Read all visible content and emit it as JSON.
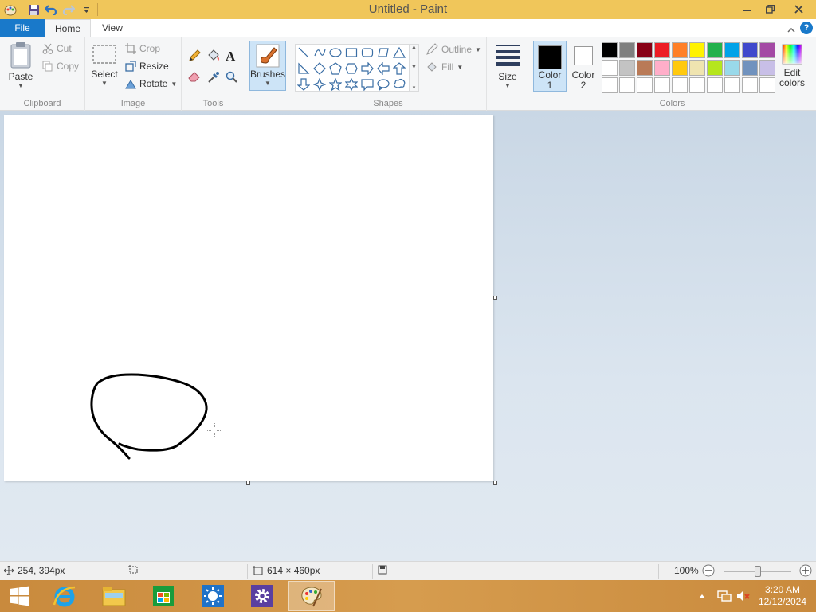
{
  "window": {
    "title": "Untitled - Paint"
  },
  "tabs": {
    "file": "File",
    "home": "Home",
    "view": "View",
    "help": "?"
  },
  "clipboard": {
    "label": "Clipboard",
    "paste": "Paste",
    "cut": "Cut",
    "copy": "Copy"
  },
  "image": {
    "label": "Image",
    "select": "Select",
    "crop": "Crop",
    "resize": "Resize",
    "rotate": "Rotate"
  },
  "tools": {
    "label": "Tools",
    "text_glyph": "A"
  },
  "brushes": {
    "label": "Brushes"
  },
  "shapes": {
    "label": "Shapes",
    "outline": "Outline",
    "fill": "Fill"
  },
  "size": {
    "label": "Size"
  },
  "colors": {
    "label": "Colors",
    "color1_label": "Color",
    "color1_num": "1",
    "color2_label": "Color",
    "color2_num": "2",
    "edit_label": "Edit",
    "edit_label2": "colors",
    "color1_value": "#000000",
    "color2_value": "#ffffff",
    "palette": [
      "#000000",
      "#7f7f7f",
      "#880015",
      "#ed1c24",
      "#ff7f27",
      "#fff200",
      "#22b14c",
      "#00a2e8",
      "#3f48cc",
      "#a349a4",
      "#ffffff",
      "#c3c3c3",
      "#b97a57",
      "#ffaec9",
      "#ffc90e",
      "#efe4b0",
      "#b5e61d",
      "#99d9ea",
      "#7092be",
      "#c8bfe7",
      "#ffffff",
      "#ffffff",
      "#ffffff",
      "#ffffff",
      "#ffffff",
      "#ffffff",
      "#ffffff",
      "#ffffff",
      "#ffffff",
      "#ffffff"
    ]
  },
  "status": {
    "cursor_pos": "254, 394px",
    "canvas_size": "614 × 460px",
    "zoom": "100%",
    "zoom_percent": 100
  },
  "taskbar": {
    "time": "3:20 AM",
    "date": "12/12/2024"
  }
}
